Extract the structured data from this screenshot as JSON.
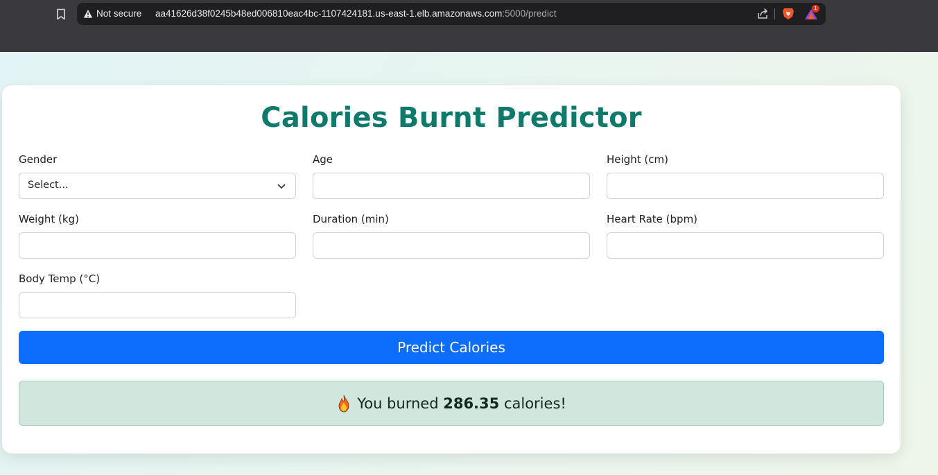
{
  "browser": {
    "security_label": "Not secure",
    "url_host": "aa41626d38f0245b48ed006810eac4bc-1107424181.us-east-1.elb.amazonaws.com",
    "url_path": ":5000/predict",
    "rewards_badge": "1"
  },
  "page": {
    "title": "Calories Burnt Predictor",
    "fields": {
      "gender": {
        "label": "Gender",
        "selected": "Select..."
      },
      "age": {
        "label": "Age",
        "value": ""
      },
      "height": {
        "label": "Height (cm)",
        "value": ""
      },
      "weight": {
        "label": "Weight (kg)",
        "value": ""
      },
      "duration": {
        "label": "Duration (min)",
        "value": ""
      },
      "heart_rate": {
        "label": "Heart Rate (bpm)",
        "value": ""
      },
      "body_temp": {
        "label": "Body Temp (°C)",
        "value": ""
      }
    },
    "predict_button": "Predict Calories",
    "result": {
      "icon": "flame-icon",
      "prefix": "You burned",
      "value": "286.35",
      "suffix": "calories!"
    }
  },
  "colors": {
    "title": "#0e7a6b",
    "primary_button": "#0d6efd",
    "result_background": "#d1e7dd",
    "result_border": "#a3cfbb",
    "browser_chrome": "#3a393e"
  }
}
